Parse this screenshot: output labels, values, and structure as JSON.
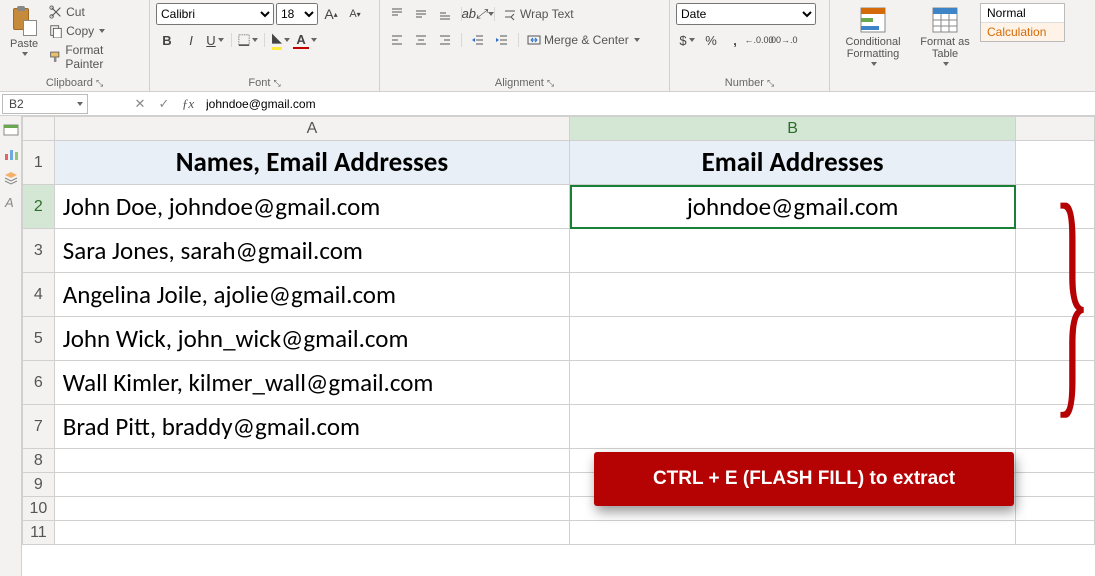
{
  "ribbon": {
    "clipboard": {
      "paste": "Paste",
      "cut": "Cut",
      "copy": "Copy",
      "format_painter": "Format Painter",
      "label": "Clipboard"
    },
    "font": {
      "name": "Calibri",
      "size": "18",
      "grow": "A",
      "shrink": "A",
      "bold": "B",
      "italic": "I",
      "underline": "U",
      "label": "Font"
    },
    "alignment": {
      "wrap": "Wrap Text",
      "merge": "Merge & Center",
      "label": "Alignment"
    },
    "number": {
      "format": "Date",
      "currency": "$",
      "percent": "%",
      "comma": ",",
      "inc_dec_a": ".0",
      "inc_dec_b": ".00",
      "label": "Number"
    },
    "styles": {
      "cond": "Conditional Formatting",
      "table": "Format as Table",
      "normal": "Normal",
      "calc": "Calculation"
    }
  },
  "name_box": "B2",
  "formula": "johndoe@gmail.com",
  "columns": {
    "A": "A",
    "B": "B"
  },
  "rows": [
    "1",
    "2",
    "3",
    "4",
    "5",
    "6",
    "7",
    "8",
    "9",
    "10",
    "11"
  ],
  "data": {
    "A1": "Names, Email Addresses",
    "B1": "Email Addresses",
    "A2": "John Doe, johndoe@gmail.com",
    "B2": "johndoe@gmail.com",
    "A3": "Sara Jones, sarah@gmail.com",
    "A4": "Angelina Joile, ajolie@gmail.com",
    "A5": "John Wick, john_wick@gmail.com",
    "A6": "Wall Kimler, kilmer_wall@gmail.com",
    "A7": "Brad Pitt, braddy@gmail.com"
  },
  "callout": "CTRL + E (FLASH FILL) to extract"
}
